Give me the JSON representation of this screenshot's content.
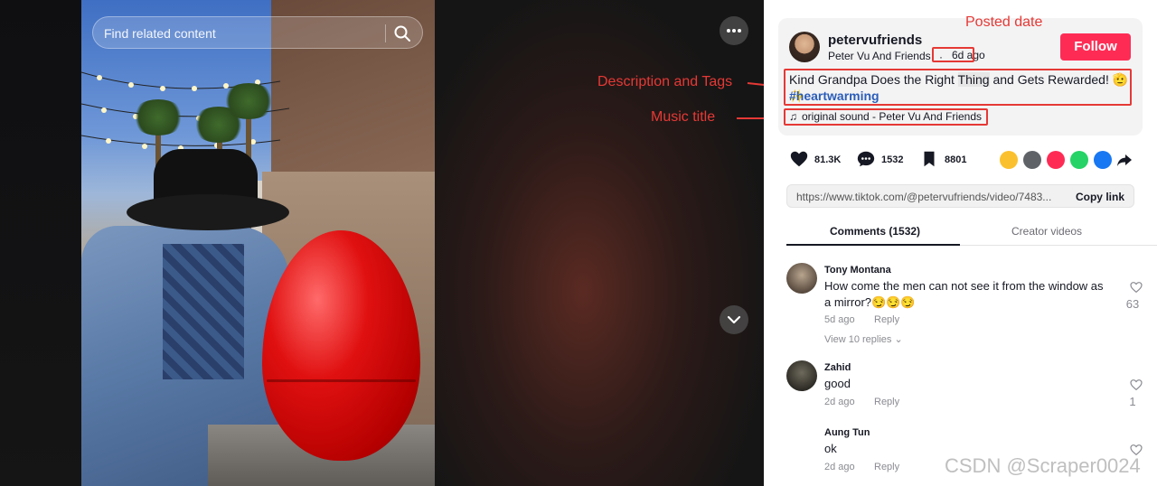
{
  "video": {
    "search_placeholder": "Find related content"
  },
  "author": {
    "username": "petervufriends",
    "nickname": "Peter Vu And Friends",
    "separator": "·",
    "posted_date": "6d ago",
    "follow_label": "Follow"
  },
  "post": {
    "description_pre": "Kind Grandpa Does the Right ",
    "description_hl": "Thing",
    "description_post": " and Gets Rewarded! 🫡✨",
    "tag": "#heartwarming",
    "music": "original sound - Peter Vu And Friends"
  },
  "stats": {
    "likes": "81.3K",
    "comments": "1532",
    "saves": "8801"
  },
  "link": {
    "url": "https://www.tiktok.com/@petervufriends/video/7483...",
    "copy_label": "Copy link"
  },
  "tabs": {
    "comments": "Comments (1532)",
    "creator": "Creator videos"
  },
  "comments": [
    {
      "name": "Tony Montana",
      "text": "How come the men can not see it from the window as a mirror?😏😏😏",
      "time": "5d ago",
      "reply": "Reply",
      "likes": "63",
      "view_replies": "View 10 replies"
    },
    {
      "name": "Zahid",
      "text": "good",
      "time": "2d ago",
      "reply": "Reply",
      "likes": "1"
    },
    {
      "name": "Aung Tun",
      "text": "ok",
      "time": "2d ago",
      "reply": "Reply"
    }
  ],
  "annotations": {
    "posted_date": "Posted date",
    "description_tags": "Description and Tags",
    "music_title": "Music title"
  },
  "watermark": "CSDN @Scraper0024",
  "colors": {
    "follow": "#fe2c55",
    "annotation": "#e53935",
    "tag": "#2b5db9"
  }
}
